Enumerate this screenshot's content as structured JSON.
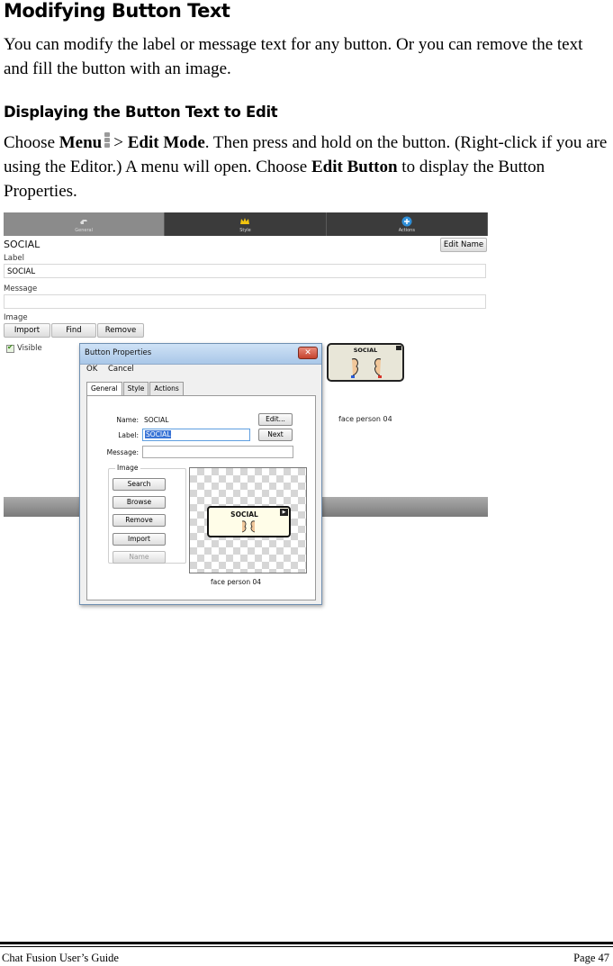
{
  "heading": "Modifying Button Text",
  "intro": "You can modify the label or message text for any button. Or you can remove the text and fill the button with an image.",
  "subheading": "Displaying the Button Text to Edit",
  "instructions": {
    "choose": "Choose",
    "menu": "Menu",
    "gt": ">",
    "edit_mode": "Edit Mode",
    "rest1": ". Then press and hold on the button. (Right-click if you are using the Editor.) A menu will open. Choose",
    "edit_button": "Edit Button",
    "rest2": "to display the Button Properties."
  },
  "app": {
    "tabs": [
      {
        "label": "General",
        "icon": "hand-icon"
      },
      {
        "label": "Style",
        "icon": "crown-icon"
      },
      {
        "label": "Actions",
        "icon": "plus-circle-icon"
      }
    ],
    "button_name": "SOCIAL",
    "edit_name_button": "Edit Name",
    "label_caption": "Label",
    "label_value": "SOCIAL",
    "message_caption": "Message",
    "message_value": "",
    "image_caption": "Image",
    "image_buttons": [
      "Import",
      "Find",
      "Remove"
    ],
    "visible_label": "Visible",
    "visible_checked": true,
    "preview_text": "SOCIAL",
    "preview_caption": "face person 04"
  },
  "dialog": {
    "title": "Button Properties",
    "menu": [
      "OK",
      "Cancel"
    ],
    "tabs": [
      "General",
      "Style",
      "Actions"
    ],
    "active_tab": "General",
    "name_label": "Name:",
    "name_value": "SOCIAL",
    "edit_button": "Edit...",
    "label_label": "Label:",
    "label_value": "SOCIAL",
    "next_button": "Next",
    "message_label": "Message:",
    "message_value": "",
    "image_group": "Image",
    "image_buttons": [
      "Search",
      "Browse",
      "Remove",
      "Import",
      "Name"
    ],
    "preview_text": "SOCIAL",
    "image_caption": "face person 04"
  },
  "footer": {
    "left": "Chat Fusion User’s Guide",
    "right": "Page 47"
  }
}
